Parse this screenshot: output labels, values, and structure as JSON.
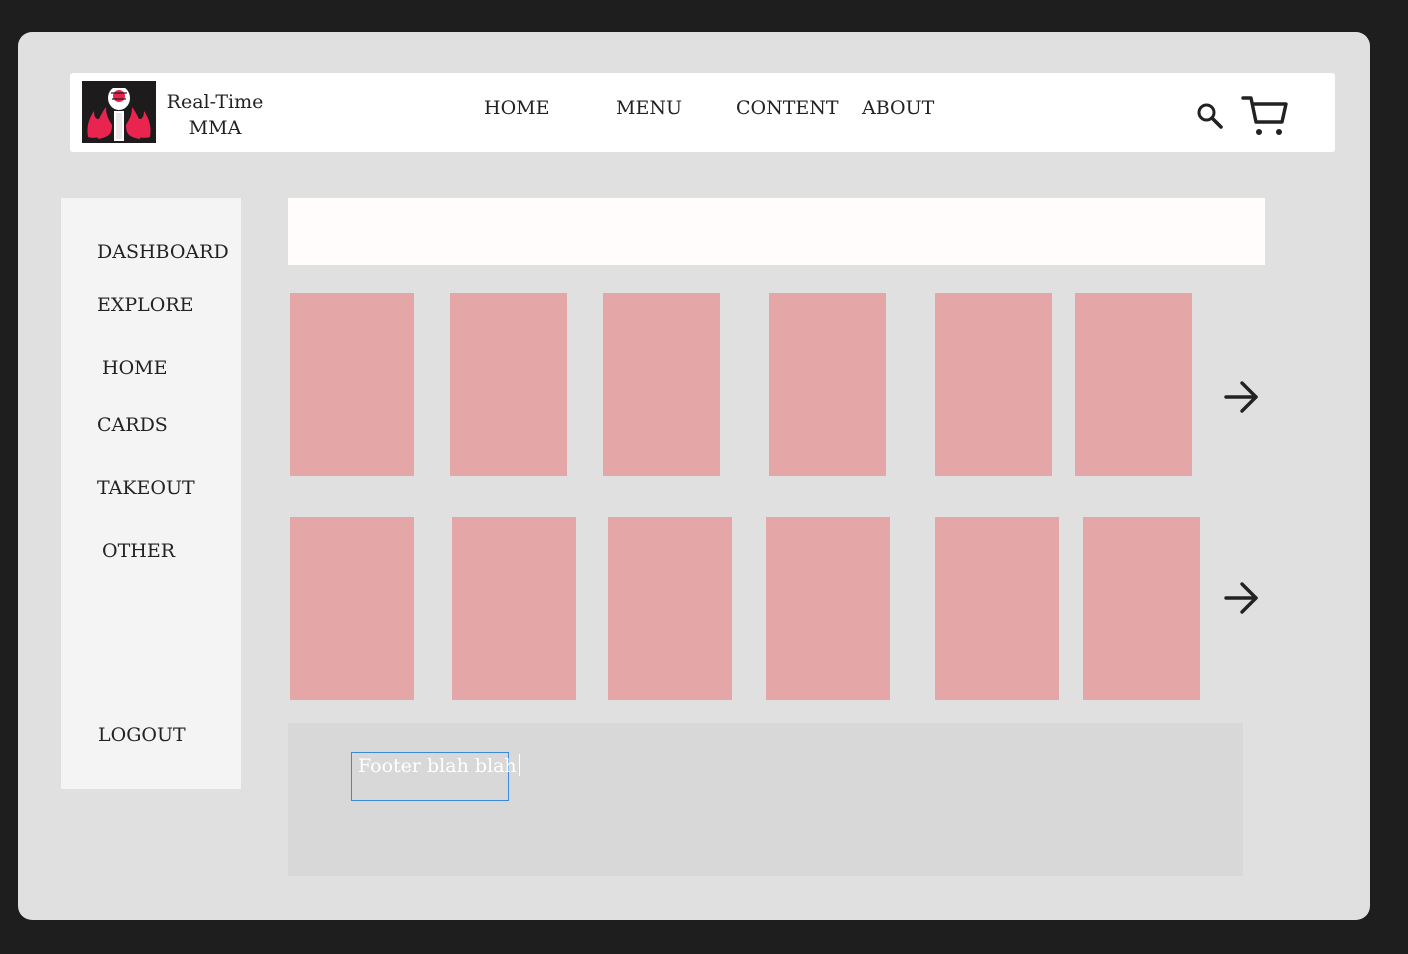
{
  "header": {
    "brand_line1": "Real-Time",
    "brand_line2": "MMA",
    "nav": [
      "HOME",
      "MENU",
      "CONTENT",
      "ABOUT"
    ]
  },
  "sidebar": {
    "items": [
      "DASHBOARD",
      "EXPLORE",
      "HOME",
      "CARDS",
      "TAKEOUT",
      "OTHER"
    ],
    "logout": "LOGOUT"
  },
  "footer": {
    "text": "Footer blah blah"
  },
  "icons": {
    "search": "search-icon",
    "cart": "cart-icon",
    "next": "arrow-right-icon"
  },
  "colors": {
    "page_bg": "#1e1e1e",
    "frame_bg": "#e1e0e1",
    "card": "#e4a6a7",
    "logo_accent": "#e8244f",
    "selection_border": "#3b8ad9"
  }
}
